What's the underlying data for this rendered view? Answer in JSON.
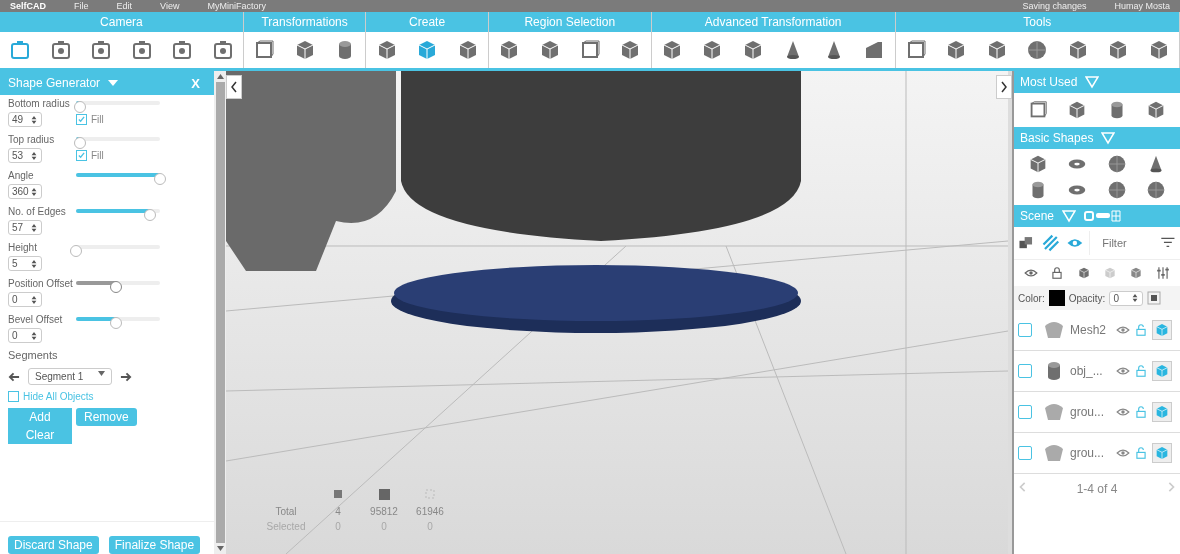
{
  "top_bar": {
    "logo": "SelfCAD",
    "menu": [
      "File",
      "Edit",
      "View",
      "MyMiniFactory"
    ],
    "status": "Saving changes",
    "user": "Humay Mosta"
  },
  "toolbar": [
    {
      "label": "Camera",
      "tools": [
        {
          "selected": true
        },
        {
          "selected": false
        },
        {
          "selected": false
        },
        {
          "selected": false
        },
        {
          "selected": false
        },
        {
          "selected": false
        }
      ]
    },
    {
      "label": "Transformations",
      "tools": [
        {
          "selected": false
        },
        {
          "selected": false
        },
        {
          "selected": false
        }
      ]
    },
    {
      "label": "Create",
      "tools": [
        {
          "selected": false
        },
        {
          "selected": true
        },
        {
          "selected": false
        }
      ]
    },
    {
      "label": "Region Selection",
      "tools": [
        {
          "selected": false
        },
        {
          "selected": false
        },
        {
          "selected": false
        },
        {
          "selected": false
        }
      ]
    },
    {
      "label": "Advanced Transformation",
      "tools": [
        {
          "selected": false
        },
        {
          "selected": false
        },
        {
          "selected": false
        },
        {
          "selected": false
        },
        {
          "selected": false
        },
        {
          "selected": false
        }
      ]
    },
    {
      "label": "Tools",
      "tools": [
        {
          "selected": false
        },
        {
          "selected": false
        },
        {
          "selected": false
        },
        {
          "selected": false
        },
        {
          "selected": false
        },
        {
          "selected": false
        },
        {
          "selected": false
        }
      ]
    }
  ],
  "shape_generator": {
    "title": "Shape Generator",
    "close": "X",
    "params": [
      {
        "label": "Bottom radius",
        "level": 0.05,
        "disabled": false,
        "value": "49",
        "fill": {
          "label": "Fill",
          "checked": true
        }
      },
      {
        "label": "Top radius",
        "level": 0.05,
        "disabled": false,
        "value": "53",
        "fill": {
          "label": "Fill",
          "checked": true
        }
      },
      {
        "label": "Angle",
        "level": 1,
        "disabled": false,
        "value": "360"
      },
      {
        "label": "No. of Edges",
        "level": 0.88,
        "disabled": false,
        "value": "57"
      },
      {
        "label": "Height",
        "level": 0,
        "disabled": false,
        "value": "5"
      },
      {
        "label": "Position Offset",
        "level": 0.48,
        "disabled": true,
        "value": "0"
      },
      {
        "label": "Bevel Offset",
        "level": 0.48,
        "disabled": false,
        "value": "0"
      }
    ],
    "segments_label": "Segments",
    "segment": "Segment 1",
    "hide_all": {
      "label": "Hide All Objects",
      "checked": false
    },
    "buttons": [
      "Add",
      "Clear",
      "Remove"
    ],
    "footer_buttons": [
      "Discard Shape",
      "Finalize Shape"
    ]
  },
  "stats": {
    "rows": [
      {
        "label": "Total",
        "values": [
          "4",
          "95812",
          "61946"
        ]
      },
      {
        "label": "Selected",
        "values": [
          "0",
          "0",
          "0"
        ]
      }
    ]
  },
  "right_panel": {
    "most_used": "Most Used",
    "basic_shapes": "Basic Shapes",
    "scene": "Scene",
    "filter_placeholder": "Filter",
    "color_label": "Color:",
    "opacity_label": "Opacity:",
    "opacity": "0",
    "objects": [
      {
        "name": "Mesh2",
        "checked": false
      },
      {
        "name": "obj_...",
        "checked": false
      },
      {
        "name": "grou...",
        "checked": false
      },
      {
        "name": "grou...",
        "checked": false
      }
    ],
    "pager": "1-4 of 4"
  }
}
